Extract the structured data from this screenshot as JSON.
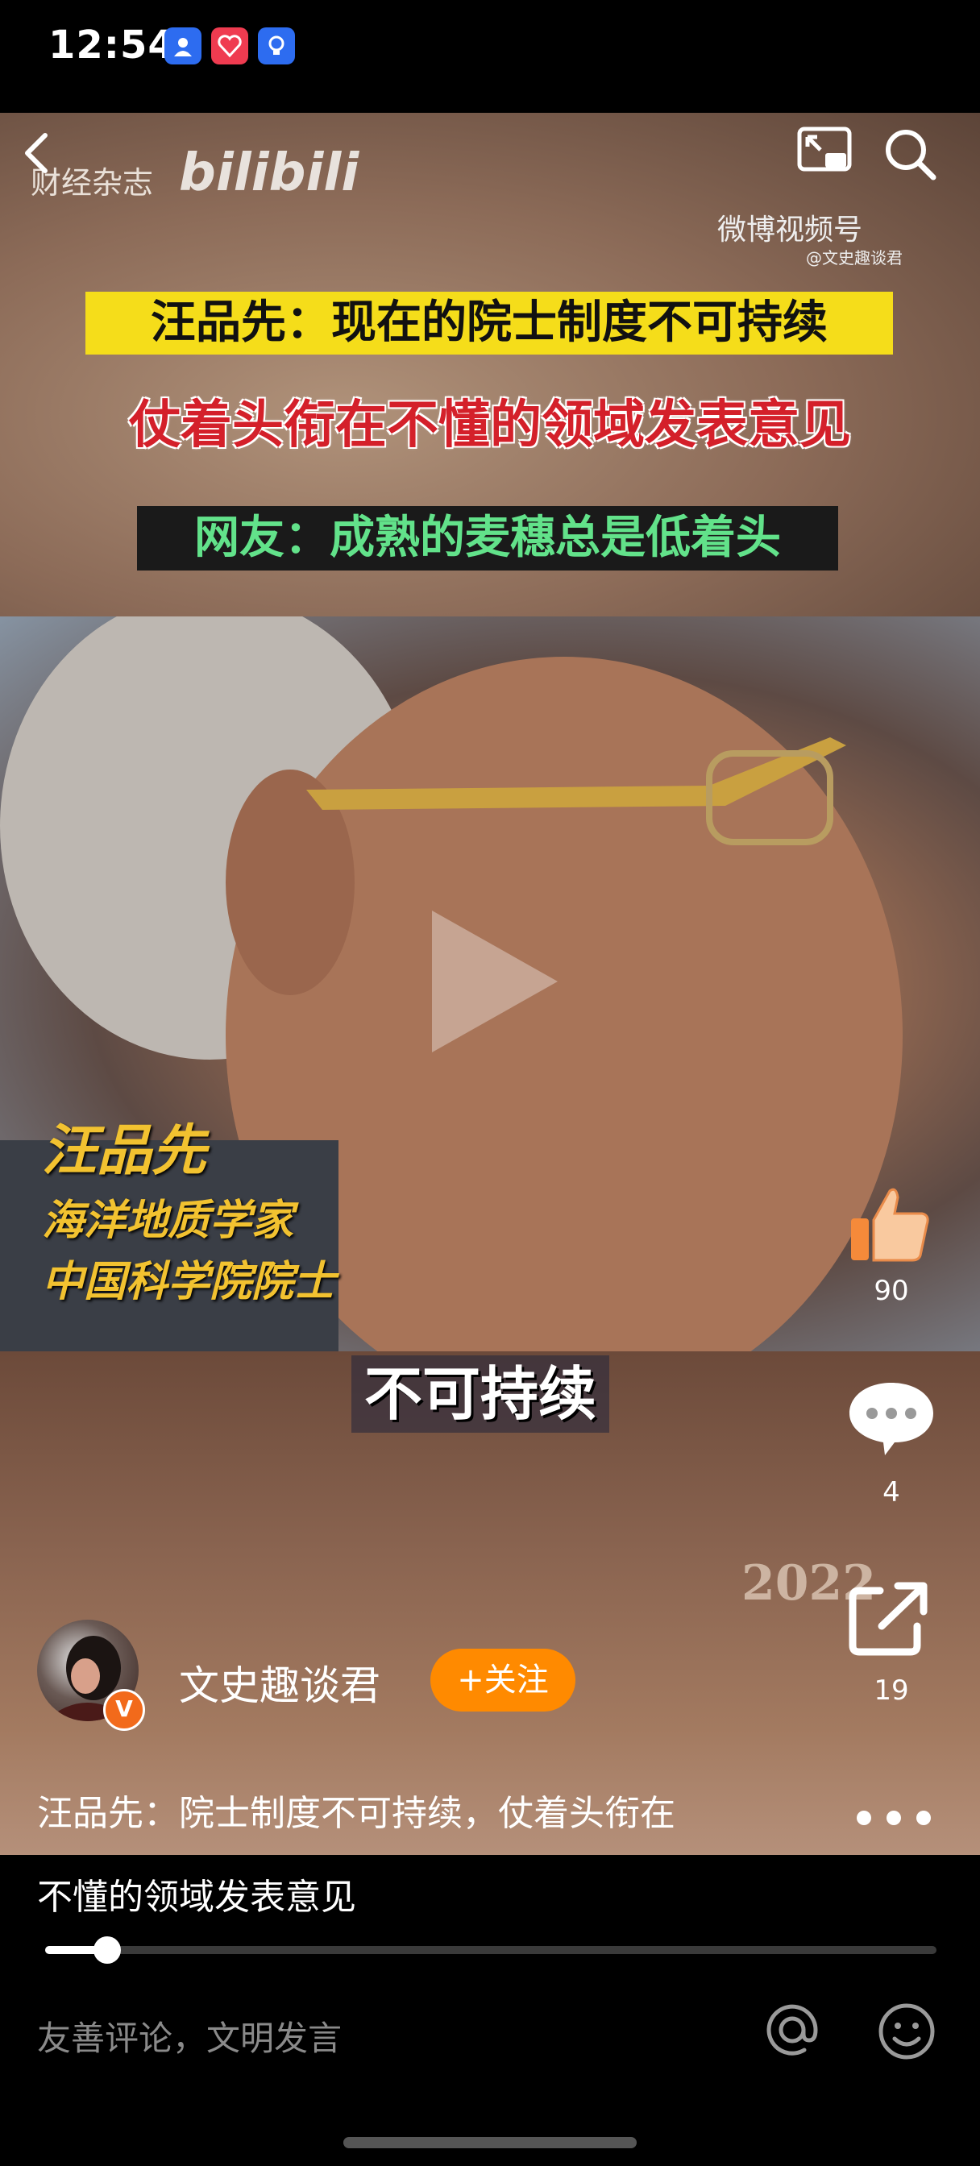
{
  "status_bar": {
    "time": "12:54"
  },
  "video": {
    "source_label": "财经杂志",
    "watermark": "bilibili",
    "weibo_label": "微博视频号",
    "weibo_handle": "@文史趣谈君",
    "banner1": "汪品先：现在的院士制度不可持续",
    "banner2": "仗着头衔在不懂的领域发表意见",
    "banner3": "网友：成熟的麦穗总是低着头",
    "caption_name": "汪品先",
    "caption_job": "海洋地质学家",
    "caption_title": "中国科学院院士",
    "subtitle": "不可持续",
    "year": "2022"
  },
  "actions": {
    "like_count": "90",
    "comment_count": "4",
    "share_count": "19"
  },
  "author": {
    "name": "文史趣谈君",
    "follow_label": "+关注",
    "badge": "V"
  },
  "description": {
    "line1": "汪品先：院士制度不可持续，仗着头衔在",
    "line2": "不懂的领域发表意见"
  },
  "progress": {
    "fraction": 0.07
  },
  "comment_bar": {
    "placeholder": "友善评论，文明发言"
  },
  "colors": {
    "accent": "#ff8a00",
    "banner_yellow": "#f5dd1a",
    "banner_red": "#d4202a",
    "banner_green": "#62e28a"
  }
}
